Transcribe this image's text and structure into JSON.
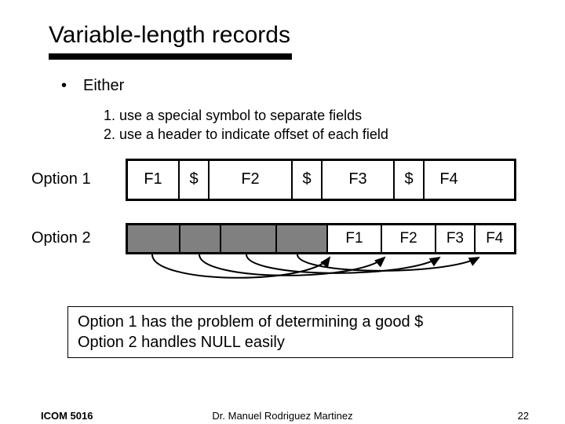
{
  "title": "Variable-length records",
  "bullet": "Either",
  "sub": {
    "s1": "1.  use a special symbol to separate fields",
    "s2": "2.  use a header to indicate offset of each field"
  },
  "label": {
    "opt1": "Option 1",
    "opt2": "Option 2"
  },
  "opt1": {
    "f1": "F1",
    "s1": "$",
    "f2": "F2",
    "s2": "$",
    "f3": "F3",
    "s3": "$",
    "f4": "F4"
  },
  "opt2": {
    "f1": "F1",
    "f2": "F2",
    "f3": "F3",
    "f4": "F4"
  },
  "note": {
    "l1": "Option 1 has the problem of determining a good $",
    "l2": "Option 2 handles NULL easily"
  },
  "footer": {
    "left": "ICOM 5016",
    "center": "Dr. Manuel Rodriguez Martinez",
    "right": "22"
  }
}
